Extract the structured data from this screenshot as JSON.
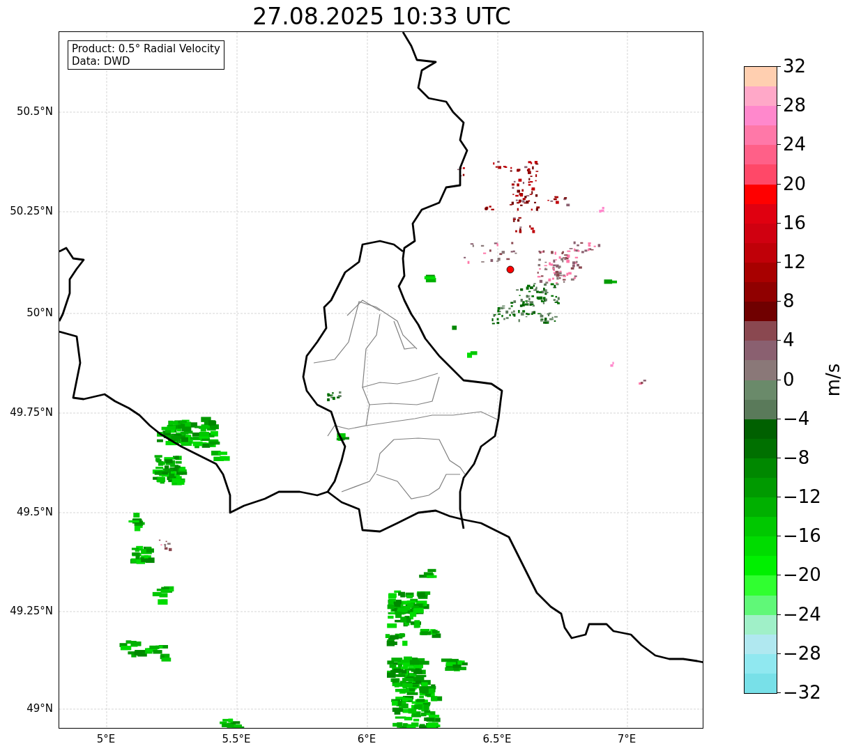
{
  "title": "27.08.2025 10:33 UTC",
  "info_box": [
    "Product: 0.5° Radial Velocity",
    "Data: DWD"
  ],
  "lat_labels": [
    "50.5°N",
    "50.25°N",
    "50°N",
    "49.75°N",
    "49.5°N",
    "49.25°N",
    "49°N"
  ],
  "lon_labels": [
    "5°E",
    "5.5°E",
    "6°E",
    "6.5°E",
    "7°E"
  ],
  "colorbar": {
    "label": "m/s",
    "ticks": [
      "32",
      "28",
      "24",
      "20",
      "16",
      "12",
      "8",
      "4",
      "0",
      "−4",
      "−8",
      "−12",
      "−16",
      "−20",
      "−24",
      "−28",
      "−32"
    ],
    "bands": [
      {
        "color": "#ffcfb0"
      },
      {
        "color": "#ffa8c8"
      },
      {
        "color": "#ff88cc"
      },
      {
        "color": "#ff78a8"
      },
      {
        "color": "#ff6088"
      },
      {
        "color": "#ff4868"
      },
      {
        "color": "#ff0000"
      },
      {
        "color": "#e00010"
      },
      {
        "color": "#d00010"
      },
      {
        "color": "#c00008"
      },
      {
        "color": "#a80000"
      },
      {
        "color": "#900000"
      },
      {
        "color": "#700000"
      },
      {
        "color": "#8a4850"
      },
      {
        "color": "#8a6070"
      },
      {
        "color": "#8a7878"
      },
      {
        "color": "#6a8a6a"
      },
      {
        "color": "#5a7a5a"
      },
      {
        "color": "#006000"
      },
      {
        "color": "#007000"
      },
      {
        "color": "#008800"
      },
      {
        "color": "#009a00"
      },
      {
        "color": "#00b000"
      },
      {
        "color": "#00c800"
      },
      {
        "color": "#00dc00"
      },
      {
        "color": "#00f000"
      },
      {
        "color": "#30ff30"
      },
      {
        "color": "#60f878"
      },
      {
        "color": "#a0f0c8"
      },
      {
        "color": "#b0e8f0"
      },
      {
        "color": "#90e8f0"
      },
      {
        "color": "#78e0e8"
      }
    ]
  }
}
